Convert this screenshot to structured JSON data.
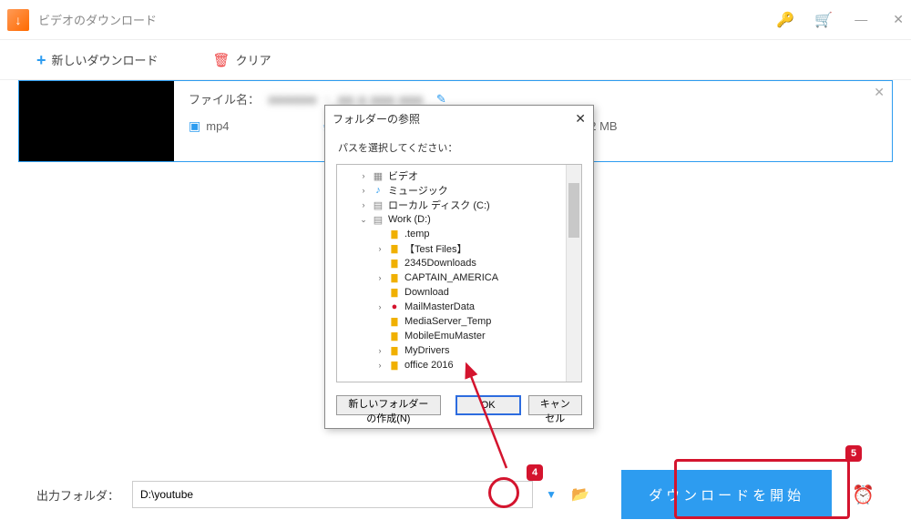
{
  "titlebar": {
    "app_title": "ビデオのダウンロード"
  },
  "toolbar": {
    "new_download": "新しいダウンロード",
    "clear": "クリア"
  },
  "item": {
    "file_label": "ファイル名：",
    "file_value": "■■■■■■ ・ ■■ ■  ■■■ ■■■",
    "format": "mp4",
    "size": "42 MB"
  },
  "dialog": {
    "title": "フォルダーの参照",
    "instruction": "パスを選択してください：",
    "nodes": [
      {
        "indent": 1,
        "exp": ">",
        "icon": "🎞",
        "label": "ビデオ"
      },
      {
        "indent": 1,
        "exp": ">",
        "icon": "♪",
        "label": "ミュージック"
      },
      {
        "indent": 1,
        "exp": ">",
        "icon": "💽",
        "label": "ローカル ディスク (C:)"
      },
      {
        "indent": 1,
        "exp": "v",
        "icon": "💽",
        "label": "Work (D:)"
      },
      {
        "indent": 2,
        "exp": "",
        "icon": "📁",
        "label": ".temp"
      },
      {
        "indent": 2,
        "exp": ">",
        "icon": "📁",
        "label": "【Test Files】"
      },
      {
        "indent": 2,
        "exp": "",
        "icon": "📁",
        "label": "2345Downloads"
      },
      {
        "indent": 2,
        "exp": ">",
        "icon": "📁",
        "label": "CAPTAIN_AMERICA"
      },
      {
        "indent": 2,
        "exp": "",
        "icon": "📁",
        "label": "Download"
      },
      {
        "indent": 2,
        "exp": ">",
        "icon": "🔴",
        "label": "MailMasterData"
      },
      {
        "indent": 2,
        "exp": "",
        "icon": "📁",
        "label": "MediaServer_Temp"
      },
      {
        "indent": 2,
        "exp": "",
        "icon": "📁",
        "label": "MobileEmuMaster"
      },
      {
        "indent": 2,
        "exp": ">",
        "icon": "📁",
        "label": "MyDrivers"
      },
      {
        "indent": 2,
        "exp": ">",
        "icon": "📁",
        "label": "office 2016"
      }
    ],
    "new_folder": "新しいフォルダーの作成(N)",
    "ok": "OK",
    "cancel": "キャンセル"
  },
  "bottom": {
    "label": "出力フォルダ：",
    "path": "D:\\youtube",
    "start": "ダウンロードを開始"
  },
  "annotations": {
    "badge4": "4",
    "badge5": "5"
  }
}
